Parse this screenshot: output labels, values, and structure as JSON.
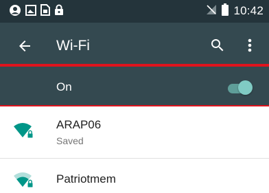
{
  "status_bar": {
    "time": "10:42",
    "icons": [
      "account-sync-icon",
      "image-notification-icon",
      "sim-notification-icon",
      "lock-notification-icon",
      "no-signal-icon",
      "battery-icon"
    ]
  },
  "app_bar": {
    "title": "Wi-Fi",
    "back_icon": "arrow-left-icon",
    "search_icon": "search-icon",
    "more_icon": "more-vert-icon"
  },
  "master_switch": {
    "label": "On",
    "state": "on"
  },
  "networks": [
    {
      "ssid": "ARAP06",
      "status": "Saved",
      "secured": true,
      "signal": "full"
    },
    {
      "ssid": "Patriotmem",
      "status": "",
      "secured": true,
      "signal": "medium"
    }
  ],
  "colors": {
    "status_bar": "#24343b",
    "app_bar": "#344950",
    "accent": "#80cbc4",
    "wifi_icon": "#009688",
    "highlight": "#e0131d"
  }
}
